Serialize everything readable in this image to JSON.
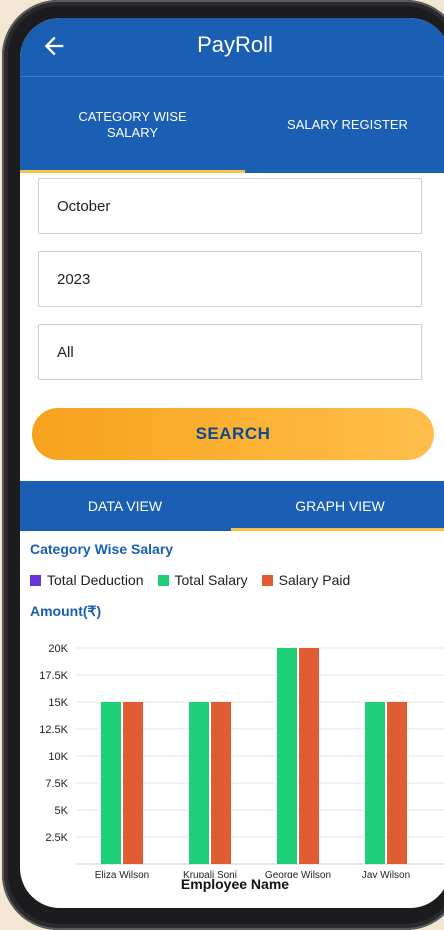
{
  "app": {
    "title": "PayRoll"
  },
  "top_tabs": [
    {
      "label": "CATEGORY WISE\nSALARY",
      "line1": "CATEGORY WISE",
      "line2": "SALARY"
    },
    {
      "label": "SALARY REGISTER"
    }
  ],
  "filters": {
    "month": "October",
    "year": "2023",
    "category": "All"
  },
  "search_label": "SEARCH",
  "view_tabs": [
    {
      "label": "DATA VIEW"
    },
    {
      "label": "GRAPH VIEW"
    }
  ],
  "section": {
    "title": "Category Wise Salary"
  },
  "colors": {
    "primary": "#1a5fb4",
    "accent": "#f5c542",
    "total_deduction": "#6a35d6",
    "total_salary": "#1fcf78",
    "salary_paid": "#e05c35"
  },
  "chart_data": {
    "type": "bar",
    "ylabel": "Amount(₹)",
    "xlabel": "Employee Name",
    "categories": [
      "Eliza Wilson",
      "Krupali Soni",
      "George Wilson",
      "Jay Wilson"
    ],
    "series": [
      {
        "name": "Total Deduction",
        "values": [
          0,
          0,
          0,
          0
        ]
      },
      {
        "name": "Total Salary",
        "values": [
          15000,
          15000,
          20000,
          15000
        ]
      },
      {
        "name": "Salary Paid",
        "values": [
          15000,
          15000,
          20000,
          15000
        ]
      }
    ],
    "ylim": [
      0,
      20000
    ],
    "yticks": [
      "2.5K",
      "5K",
      "7.5K",
      "10K",
      "12.5K",
      "15K",
      "17.5K",
      "20K"
    ],
    "legend_position": "top",
    "grid": true
  }
}
